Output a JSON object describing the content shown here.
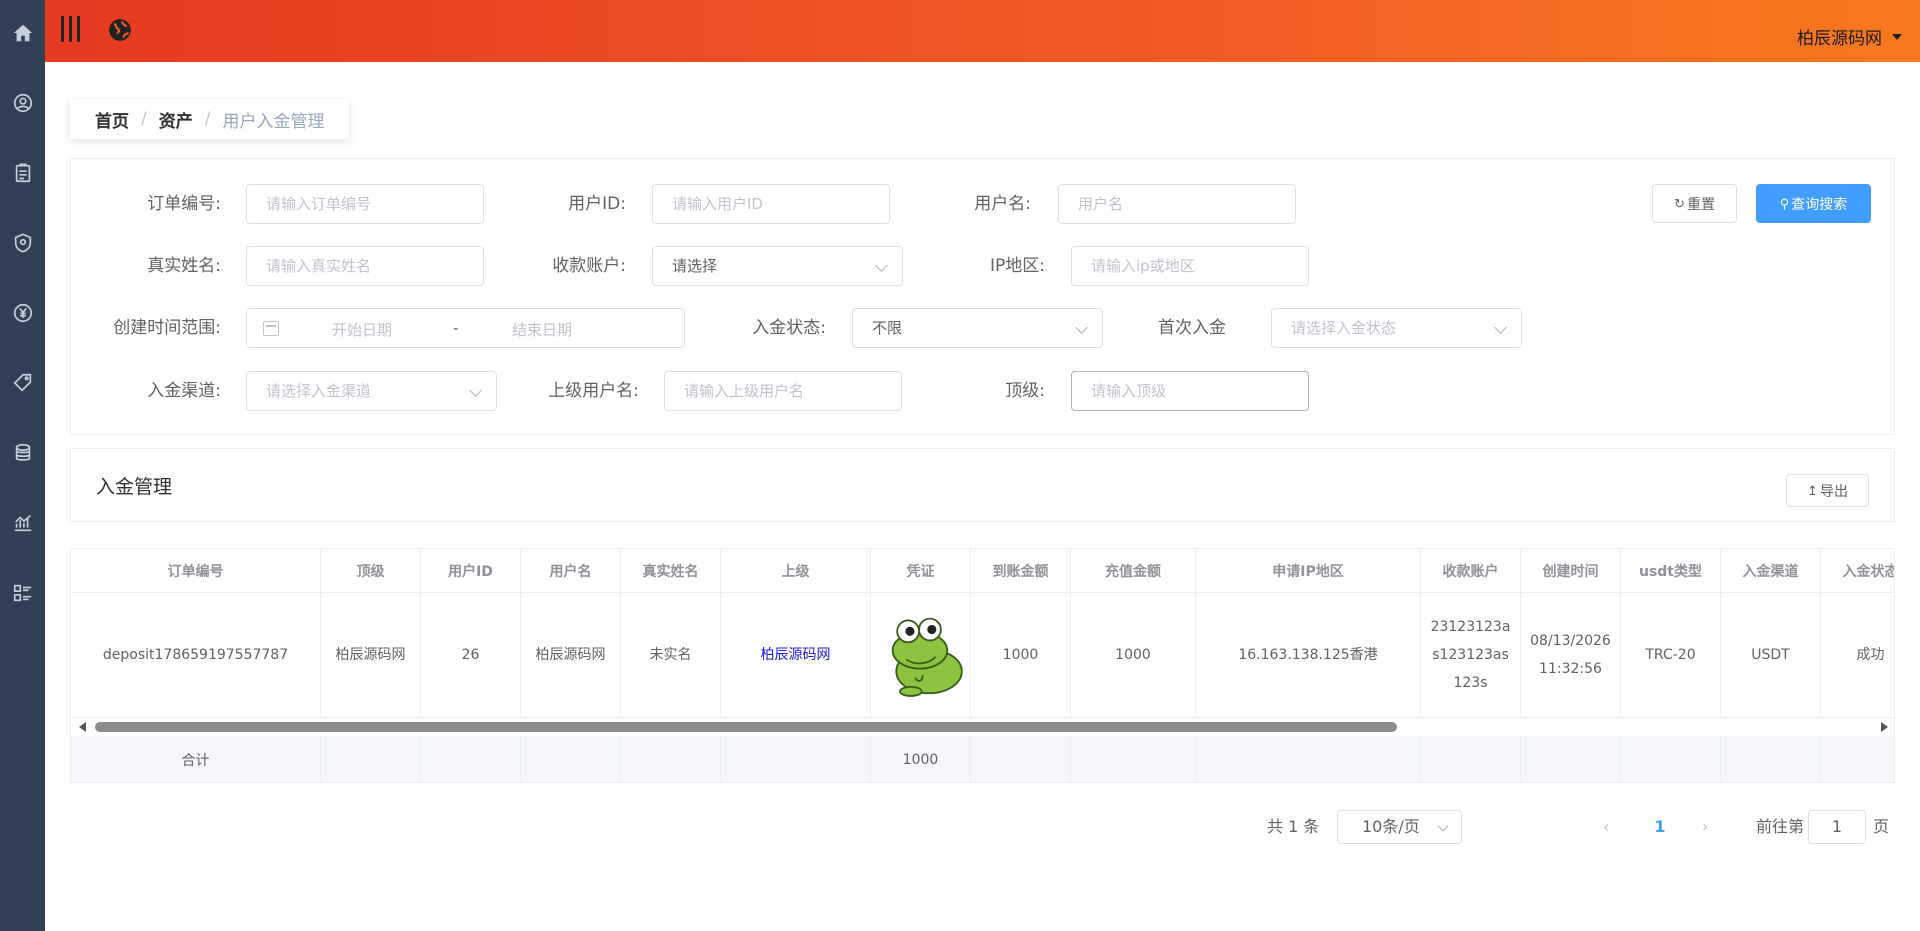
{
  "header": {
    "username": "柏辰源码网"
  },
  "breadcrumb": {
    "items": [
      "首页",
      "资产",
      "用户入金管理"
    ]
  },
  "filters": {
    "order_no": {
      "label": "订单编号:",
      "placeholder": "请输入订单编号"
    },
    "user_id": {
      "label": "用户ID:",
      "placeholder": "请输入用户ID"
    },
    "username": {
      "label": "用户名:",
      "placeholder": "用户名"
    },
    "real_name": {
      "label": "真实姓名:",
      "placeholder": "请输入真实姓名"
    },
    "account": {
      "label": "收款账户:",
      "value": "请选择"
    },
    "ip_region": {
      "label": "IP地区:",
      "placeholder": "请输入ip或地区"
    },
    "created_range": {
      "label": "创建时间范围:",
      "start_placeholder": "开始日期",
      "separator": "-",
      "end_placeholder": "结束日期"
    },
    "deposit_status": {
      "label": "入金状态:",
      "value": "不限"
    },
    "first_deposit": {
      "label": "首次入金",
      "placeholder": "请选择入金状态"
    },
    "channel": {
      "label": "入金渠道:",
      "placeholder": "请选择入金渠道"
    },
    "parent_username": {
      "label": "上级用户名:",
      "placeholder": "请输入上级用户名"
    },
    "top_level": {
      "label": "顶级:",
      "placeholder": "请输入顶级"
    },
    "reset_label": "重置",
    "search_label": "查询搜索"
  },
  "table_card": {
    "title": "入金管理",
    "export_label": "导出"
  },
  "table": {
    "columns": [
      "订单编号",
      "顶级",
      "用户ID",
      "用户名",
      "真实姓名",
      "上级",
      "凭证",
      "到账金额",
      "充值金额",
      "申请IP地区",
      "收款账户",
      "创建时间",
      "usdt类型",
      "入金渠道",
      "入金状态"
    ],
    "rows": [
      {
        "order_no": "deposit178659197557787",
        "top_level": "柏辰源码网",
        "user_id": "26",
        "username": "柏辰源码网",
        "real_name": "未实名",
        "parent": "柏辰源码网",
        "voucher": "frog-image",
        "received_amount": "1000",
        "recharge_amount": "1000",
        "ip_region": "16.163.138.125香港",
        "account": "23123123as123123as123s",
        "created_time": "08/13/2026 11:32:56",
        "usdt_type": "TRC-20",
        "channel": "USDT",
        "status": "成功"
      }
    ],
    "footer": {
      "label": "合计",
      "voucher_total": "1000"
    }
  },
  "pagination": {
    "total": "共 1 条",
    "page_size": "10条/页",
    "current_page": "1",
    "goto_label": "前往第",
    "goto_value": "1",
    "page_suffix": "页"
  },
  "colors": {
    "sidebar": "#304156",
    "header_start": "#e63a22",
    "header_end": "#f7791f",
    "primary": "#409eff",
    "link": "#1a1ae6"
  }
}
